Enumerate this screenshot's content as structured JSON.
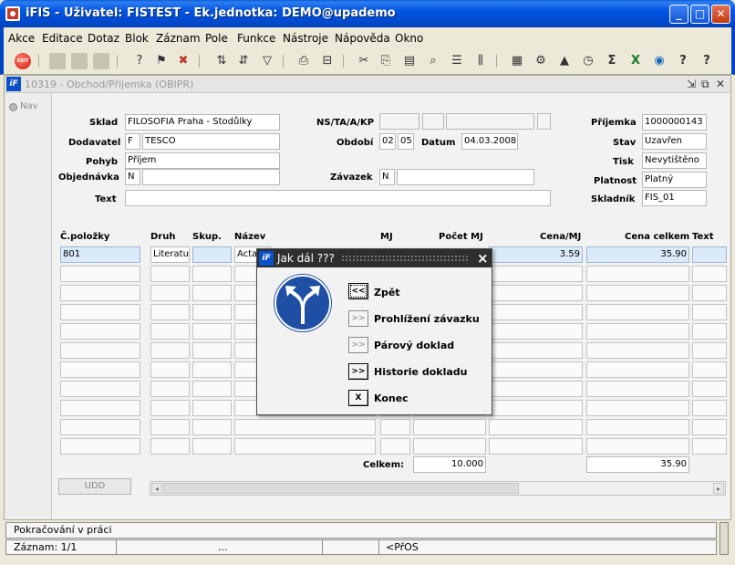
{
  "window": {
    "title": "iFIS - Uživatel: FISTEST - Ek.jednotka: DEMO@upademo"
  },
  "menu": [
    "Akce",
    "Editace",
    "Dotaz",
    "Blok",
    "Záznam",
    "Pole",
    "Funkce",
    "Nástroje",
    "Nápověda",
    "Okno"
  ],
  "toolbar": {
    "exit_label": "EXIT"
  },
  "form": {
    "title": "10319 - Obchod/Příjemka (OBIPR)",
    "nav_label": "Nav",
    "labels": {
      "sklad": "Sklad",
      "dodavatel": "Dodavatel",
      "pohyb": "Pohyb",
      "objednavka": "Objednávka",
      "text": "Text",
      "ns": "NS/TA/A/KP",
      "obdobi": "Období",
      "datum": "Datum",
      "zavazek": "Závazek",
      "prijemka": "Příjemka",
      "stav": "Stav",
      "tisk": "Tisk",
      "platnost": "Platnost",
      "skladnik": "Skladník"
    },
    "values": {
      "sklad": "FILOSOFIA Praha - Stodůlky",
      "dodavatel_code": "F",
      "dodavatel": "TESCO",
      "pohyb": "Příjem",
      "objednavka_flag": "N",
      "obdobi_1": "02",
      "obdobi_2": "05",
      "datum": "04.03.2008",
      "zavazek_flag": "N",
      "prijemka": "1000000143",
      "stav": "Uzavřen",
      "tisk": "Nevytištěno",
      "platnost": "Platný",
      "skladnik": "FIS_01"
    },
    "table": {
      "headers": {
        "cislo": "Č.položky",
        "druh": "Druh",
        "skup": "Skup.",
        "nazev": "Název",
        "mj": "MJ",
        "pocet": "Počet MJ",
        "cena_mj": "Cena/MJ",
        "cena_celkem": "Cena celkem",
        "text": "Text"
      },
      "row1": {
        "cislo": "801",
        "druh": "Literatur",
        "nazev": "Acta",
        "cena_mj": "3.59",
        "cena_celkem": "35.90"
      }
    },
    "totals": {
      "label": "Celkem:",
      "pocet": "10.000",
      "cena": "35.90"
    },
    "udd_label": "UDD"
  },
  "dialog": {
    "title": "Jak dál ???",
    "buttons": [
      {
        "symbol": "<<",
        "label": "Zpět"
      },
      {
        "symbol": ">>",
        "label": "Prohlížení závazku"
      },
      {
        "symbol": ">>",
        "label": "Párový doklad"
      },
      {
        "symbol": ">>",
        "label": "Historie dokladu"
      },
      {
        "symbol": "X",
        "label": "Konec"
      }
    ]
  },
  "status": {
    "line1": "Pokračování v práci",
    "record": "Záznam: 1/1",
    "ellipsis": "...",
    "mode": "<PřOS"
  },
  "colors": {
    "titlebar": "#0054e3",
    "selected_field": "#dbeaf8",
    "sign": "#1e4fa5"
  }
}
